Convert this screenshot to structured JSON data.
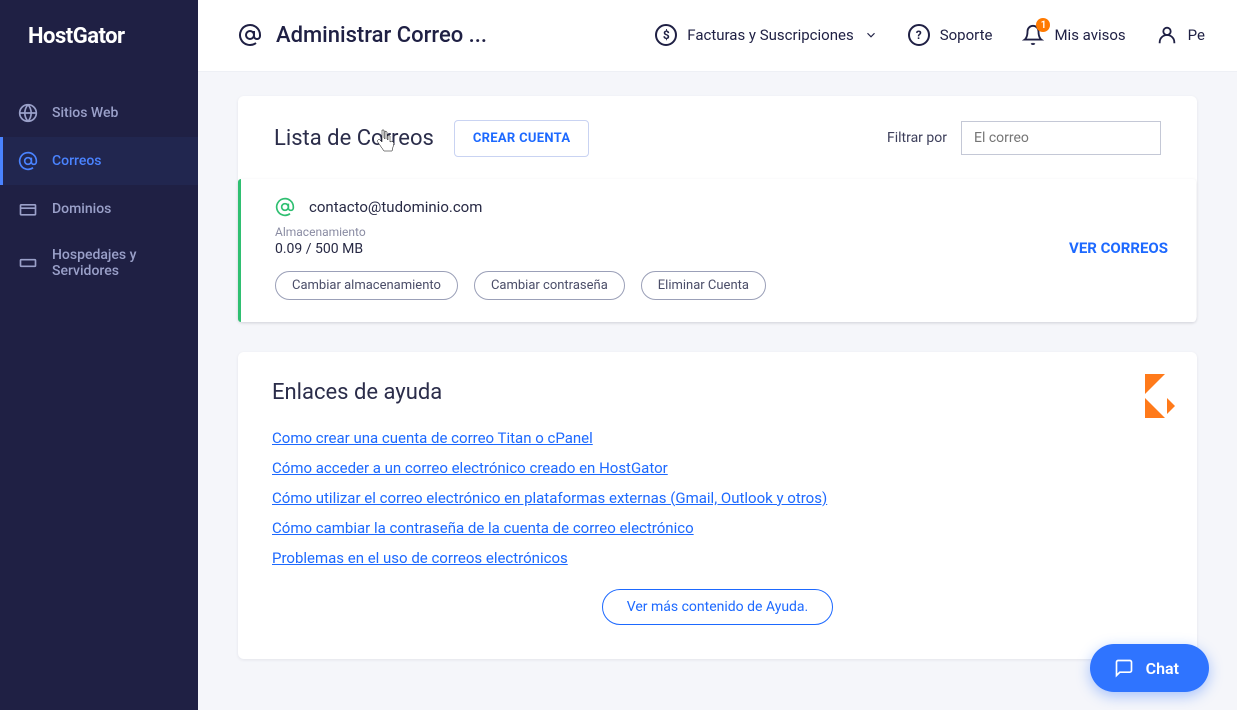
{
  "brand": "HostGator",
  "sidebar": {
    "items": [
      {
        "label": "Sitios Web"
      },
      {
        "label": "Correos"
      },
      {
        "label": "Dominios"
      },
      {
        "label": "Hospedajes y Servidores"
      }
    ]
  },
  "topbar": {
    "title": "Administrar Correo ...",
    "billing": "Facturas y Suscripciones",
    "support": "Soporte",
    "notices": "Mis avisos",
    "notices_badge": "1",
    "profile": "Pe"
  },
  "list": {
    "title": "Lista de Correos",
    "create_btn": "CREAR CUENTA",
    "filter_label": "Filtrar por",
    "filter_placeholder": "El correo"
  },
  "email": {
    "address": "contacto@tudominio.com",
    "storage_label": "Almacenamiento",
    "storage_value": "0.09 / 500 MB",
    "actions": {
      "change_storage": "Cambiar almacenamiento",
      "change_password": "Cambiar contraseña",
      "delete": "Eliminar Cuenta"
    },
    "view": "VER CORREOS"
  },
  "help": {
    "title": "Enlaces de ayuda",
    "links": [
      "Como crear una cuenta de correo Titan o cPanel",
      "Cómo acceder a un correo electrónico creado en HostGator",
      "Cómo utilizar el correo electrónico en plataformas externas (Gmail, Outlook y otros)",
      "Cómo cambiar la contraseña de la cuenta de correo electrónico",
      "Problemas en el uso de correos electrónicos"
    ],
    "more": "Ver más contenido de Ayuda."
  },
  "chat": "Chat"
}
